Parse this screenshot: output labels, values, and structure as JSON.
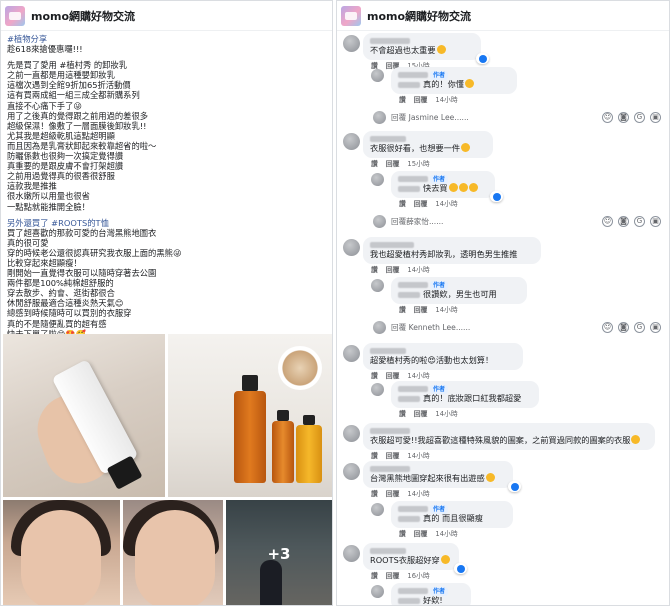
{
  "left": {
    "group_title": "momo網購好物交流",
    "post_lines": [
      {
        "text": "#植物分享",
        "tag": true
      },
      {
        "text": "趁618來搶優惠囉!!!"
      },
      {
        "gap": true
      },
      {
        "text": "先是買了愛用 #植村秀 的卸妝乳"
      },
      {
        "text": "之前一直都是用這種嬰卸妝乳"
      },
      {
        "text": "這檔次遇到全館9折加65折活動價"
      },
      {
        "text": "這有買兩成組一組三成全都新購系列"
      },
      {
        "text": "直接不心痛下手了😜"
      },
      {
        "text": "用了之後真的覺得跟之前用過的差很多"
      },
      {
        "text": "超級保濕！像敷了一層面膜後卸妝乳!!"
      },
      {
        "text": "尤其我是超級乾肌這點超明顯"
      },
      {
        "text": "而且因為是乳膏狀卸起來較靠超省的啦～"
      },
      {
        "text": "防曬係數也很夠一次搞定覺得讚"
      },
      {
        "text": "真重要的是跟皮膚不會打架超讚"
      },
      {
        "text": "之前用過覺得真的很香很舒服"
      },
      {
        "text": "這款我是推推"
      },
      {
        "text": "很水嫩所以用量也很省"
      },
      {
        "text": "一點點就能推開全臉！"
      },
      {
        "gap": true
      },
      {
        "text": "另外還買了 #ROOTS的T恤",
        "tag": true
      },
      {
        "text": "買了超喜歡的那款可愛的台灣黑熊地圖衣"
      },
      {
        "text": "真的很可愛"
      },
      {
        "text": "穿的時候老公還很認真研究我衣服上面的黑熊😜"
      },
      {
        "text": "比較穿起來超顯瘦！"
      },
      {
        "text": "剛開始一直覺得衣服可以隨時穿著去公園"
      },
      {
        "text": "兩件都是100%純棉超舒服的"
      },
      {
        "text": "穿去散步、約會、逛街都很合"
      },
      {
        "text": "休閒舒服最適合這種炎熱天氣😊"
      },
      {
        "text": "總感到時候隨時可以買別的衣服穿"
      },
      {
        "text": "真的不是隨便亂買的超有感"
      },
      {
        "text": "快去下單了啦😋🤩🥰"
      }
    ],
    "more_photos": "+3"
  },
  "right": {
    "group_title": "momo網購好物交流",
    "comments": [
      {
        "text": "不會超過也太重要",
        "name_blur": 40,
        "author": false,
        "meta": [
          "讚",
          "回覆",
          "15小時"
        ],
        "emoji": 1
      },
      {
        "text": "真的！你懂",
        "name_blur": 30,
        "author": true,
        "author_label": "作者",
        "meta": [
          "讚",
          "回覆",
          "14小時"
        ],
        "emoji": 1
      },
      {
        "reply": "回覆 Jasmine Lee......"
      },
      {
        "text": "衣服很好看，也想要一件",
        "name_blur": 36,
        "author": false,
        "meta": [
          "讚",
          "回覆",
          "15小時"
        ],
        "emoji": 1
      },
      {
        "text": "快去買",
        "name_blur": 30,
        "author": true,
        "author_label": "作者",
        "meta": [
          "讚",
          "回覆",
          "14小時"
        ],
        "emoji": 3
      },
      {
        "reply": "回覆薛家怡......"
      },
      {
        "text": "我也超愛植村秀卸妝乳，透明色男生推推",
        "name_blur": 44,
        "author": false,
        "meta": [
          "讚",
          "回覆",
          "14小時"
        ],
        "emoji": 0
      },
      {
        "text": "很讚欸，男生也可用",
        "name_blur": 30,
        "author": true,
        "author_label": "作者",
        "meta": [
          "讚",
          "回覆",
          "14小時"
        ],
        "emoji": 0
      },
      {
        "reply": "回覆 Kenneth Lee......"
      },
      {
        "text": "超愛植村秀的啦😍活動也太划算！",
        "name_blur": 36,
        "author": false,
        "meta": [
          "讚",
          "回覆",
          "14小時"
        ],
        "emoji": 0
      },
      {
        "text": "真的！底妝跟口紅我都超愛",
        "name_blur": 30,
        "author": true,
        "author_label": "作者",
        "meta": [
          "讚",
          "回覆",
          "14小時"
        ],
        "emoji": 0
      },
      {
        "text": "衣服超可愛!!我超喜歡這種特殊風貌的圖案，之前買過同款的圖案的衣服",
        "name_blur": 40,
        "author": false,
        "meta": [
          "讚",
          "回覆",
          "14小時"
        ],
        "emoji": 1
      },
      {
        "text": "台灣黑熊地圖穿起來很有出遊感",
        "name_blur": 40,
        "author": false,
        "meta": [
          "讚",
          "回覆",
          "14小時"
        ],
        "emoji": 1
      },
      {
        "text": "真的 而且很顯瘦",
        "name_blur": 30,
        "author": true,
        "author_label": "作者",
        "meta": [
          "讚",
          "回覆",
          "14小時"
        ],
        "emoji": 0
      },
      {
        "text": "ROOTS衣服超好穿",
        "name_blur": 36,
        "author": false,
        "meta": [
          "讚",
          "回覆",
          "16小時"
        ],
        "emoji": 1
      },
      {
        "text": "好欸!",
        "name_blur": 30,
        "author": true,
        "author_label": "作者",
        "meta": [],
        "emoji": 0
      }
    ],
    "icon_names": [
      "emoji-icon",
      "camera-icon",
      "gif-icon",
      "sticker-icon"
    ]
  }
}
